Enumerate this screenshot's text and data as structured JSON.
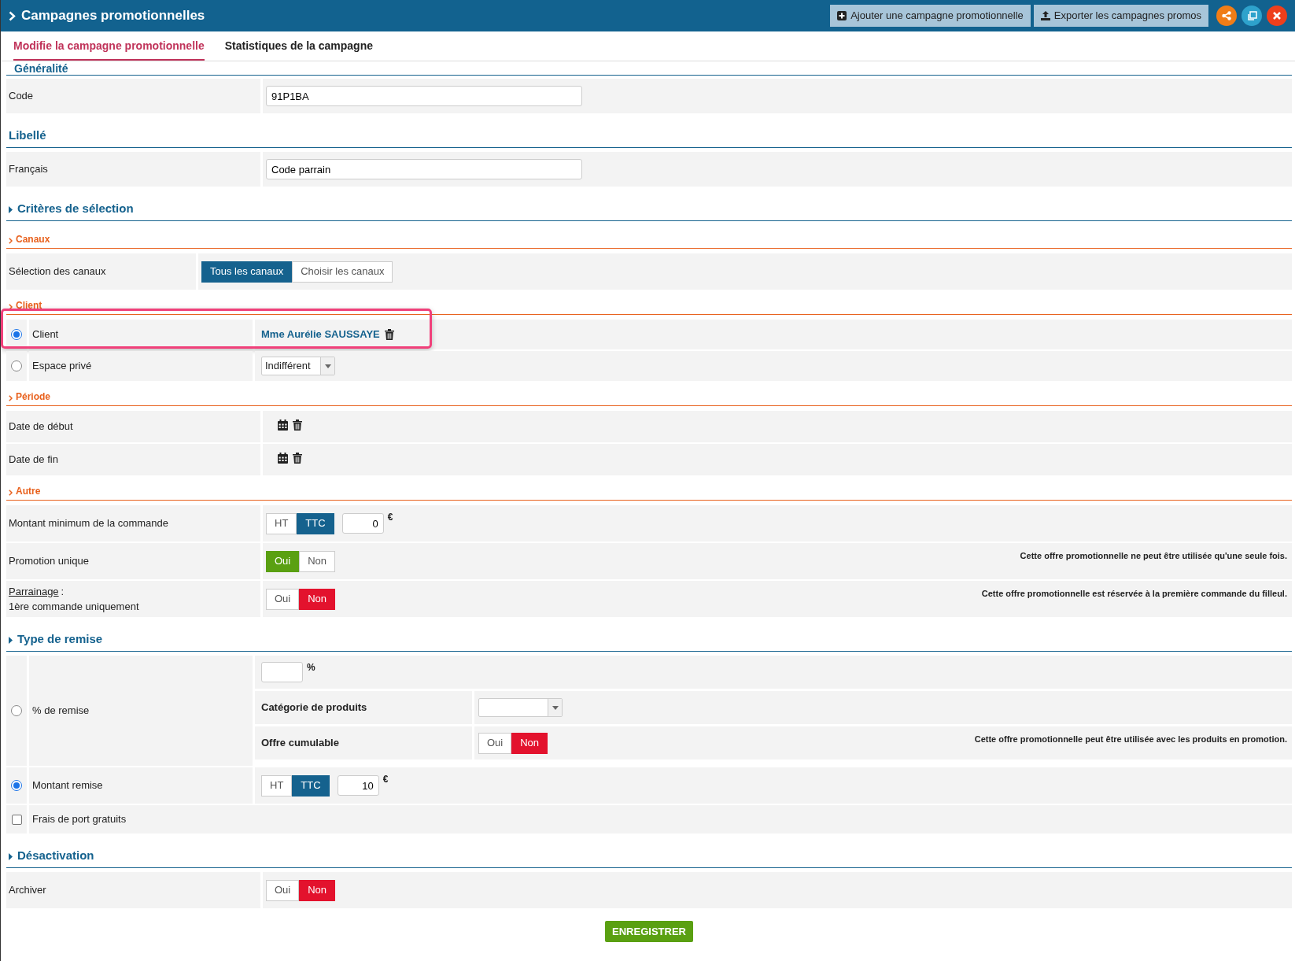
{
  "header": {
    "title": "Campagnes promotionnelles",
    "buttons": [
      {
        "kind": "add",
        "label": "Ajouter une campagne promotionnelle"
      },
      {
        "kind": "export",
        "label": "Exporter les campagnes promos"
      }
    ],
    "round_buttons": [
      {
        "kind": "share"
      },
      {
        "kind": "copy"
      },
      {
        "kind": "close"
      }
    ]
  },
  "tabs": [
    {
      "label": "Modifie la campagne promotionnelle",
      "selected": true
    },
    {
      "label": "Statistiques de la campagne",
      "selected": false
    }
  ],
  "sections": [
    {
      "kind": "clipped",
      "title": "Généralité",
      "rows": [
        {
          "kind": "text",
          "label": "Code",
          "value": "91P1BA"
        }
      ]
    },
    {
      "kind": "main",
      "title": "Libellé",
      "collapsible": false,
      "rows": [
        {
          "kind": "text",
          "label": "Français",
          "value": "Code parrain"
        }
      ]
    },
    {
      "kind": "main",
      "title": "Critères de sélection",
      "collapsible": true
    },
    {
      "kind": "sub",
      "title": "Canaux",
      "rows": [
        {
          "kind": "toggle",
          "label": "Sélection des canaux",
          "options": [
            {
              "label": "Tous les canaux",
              "selected": true
            },
            {
              "label": "Choisir les canaux",
              "selected": false
            }
          ]
        }
      ]
    },
    {
      "kind": "sub",
      "title": "Client",
      "rows": [
        {
          "kind": "radio",
          "label": "Client",
          "selected": true,
          "highlighted": true,
          "value": {
            "kind": "link",
            "text": "Mme Aurélie SAUSSAYE"
          }
        },
        {
          "kind": "radio",
          "label": "Espace privé",
          "selected": false,
          "highlighted": false,
          "value": {
            "kind": "select",
            "text": "Indifférent"
          }
        }
      ]
    },
    {
      "kind": "sub",
      "title": "Période",
      "rows": [
        {
          "kind": "date",
          "label": "Date de début"
        },
        {
          "kind": "date",
          "label": "Date de fin"
        }
      ]
    },
    {
      "kind": "sub",
      "title": "Autre",
      "rows": [
        {
          "kind": "amount",
          "label": "Montant minimum de la commande",
          "options": [
            {
              "label": "HT",
              "selected": false
            },
            {
              "label": "TTC",
              "selected": true
            }
          ],
          "value": "0",
          "unit": "€"
        },
        {
          "kind": "yesno",
          "label": "Promotion unique",
          "options": [
            {
              "label": "Oui",
              "selected": true
            },
            {
              "label": "Non",
              "selected": false
            }
          ],
          "note": "Cette offre promotionnelle ne peut être utilisée qu'une seule fois."
        },
        {
          "kind": "yesno",
          "label_link": "Parrainage",
          "label": ":",
          "sublabel": "1ère commande uniquement",
          "options": [
            {
              "label": "Oui",
              "selected": false
            },
            {
              "label": "Non",
              "selected": true
            }
          ],
          "note": "Cette offre promotionnelle est réservée à la première commande du filleul."
        }
      ]
    },
    {
      "kind": "main",
      "title": "Type de remise",
      "collapsible": true,
      "rows": [
        {
          "kind": "radio_group",
          "label": "% de remise",
          "selected": false,
          "unit": "%",
          "category_label": "Catégorie de produits",
          "cumul_label": "Offre cumulable",
          "cumul_options": [
            {
              "label": "Oui",
              "selected": false
            },
            {
              "label": "Non",
              "selected": true
            }
          ],
          "note": "Cette offre promotionnelle peut être utilisée avec les produits en promotion."
        },
        {
          "kind": "radio_amount",
          "label": "Montant remise",
          "selected": true,
          "options": [
            {
              "label": "HT",
              "selected": false
            },
            {
              "label": "TTC",
              "selected": true
            }
          ],
          "value": "10",
          "unit": "€"
        },
        {
          "kind": "checkbox",
          "label": "Frais de port gratuits",
          "checked": false
        }
      ]
    },
    {
      "kind": "main",
      "title": "Désactivation",
      "collapsible": true,
      "rows": [
        {
          "kind": "yesno",
          "label": "Archiver",
          "options": [
            {
              "label": "Oui",
              "selected": false
            },
            {
              "label": "Non",
              "selected": true
            }
          ]
        }
      ]
    }
  ],
  "save": "ENREGISTRER"
}
